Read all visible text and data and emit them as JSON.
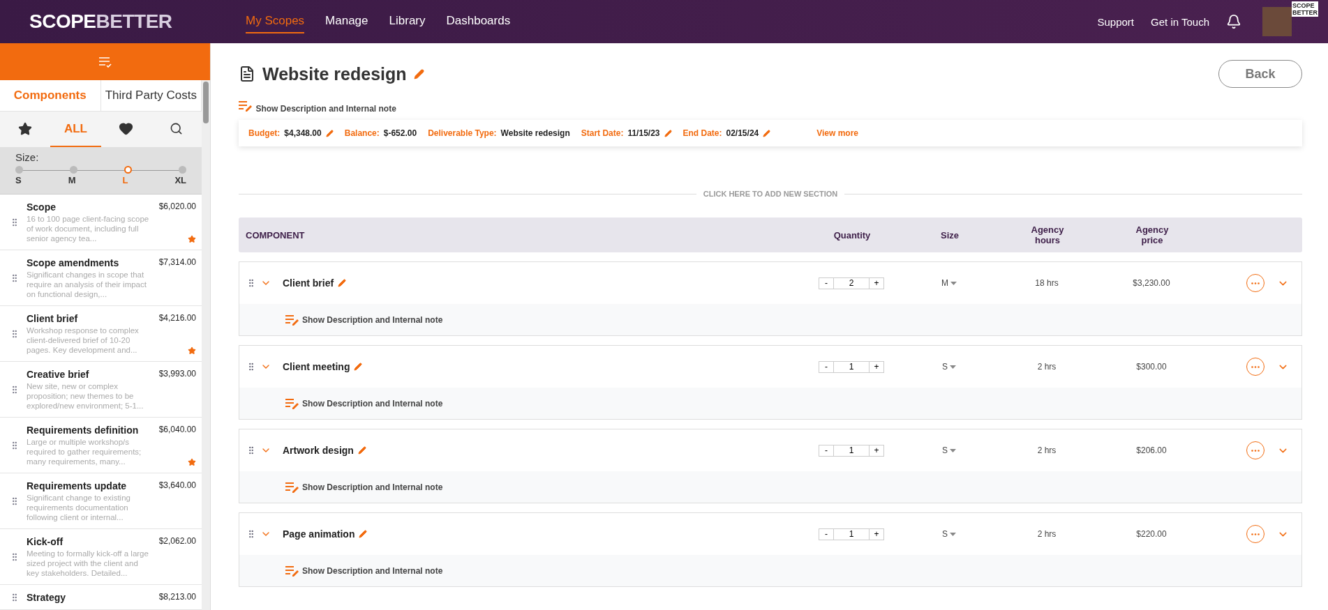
{
  "header": {
    "logo_left": "SCOPE",
    "logo_right": "BETTER",
    "nav": [
      {
        "label": "My Scopes",
        "selected": true
      },
      {
        "label": "Manage",
        "selected": false
      },
      {
        "label": "Library",
        "selected": false
      },
      {
        "label": "Dashboards",
        "selected": false
      }
    ],
    "links": [
      "Support",
      "Get in Touch"
    ],
    "avatar_logo": [
      "SCOPE",
      "BETTER"
    ]
  },
  "sidebar": {
    "tabs": [
      {
        "label": "Components",
        "selected": true
      },
      {
        "label": "Third Party Costs",
        "selected": false
      }
    ],
    "filters": [
      {
        "kind": "star",
        "selected": false
      },
      {
        "kind": "all",
        "label": "ALL",
        "selected": true
      },
      {
        "kind": "heart",
        "selected": false
      },
      {
        "kind": "search",
        "selected": false
      }
    ],
    "size": {
      "label": "Size:",
      "options": [
        {
          "label": "S",
          "selected": false
        },
        {
          "label": "M",
          "selected": false
        },
        {
          "label": "L",
          "selected": true
        },
        {
          "label": "XL",
          "selected": false
        }
      ]
    },
    "components": [
      {
        "name": "Scope",
        "price": "$6,020.00",
        "description": "16 to 100 page client-facing scope of work document, including full senior agency tea...",
        "starred": true
      },
      {
        "name": "Scope amendments",
        "price": "$7,314.00",
        "description": "Significant changes in scope that require an analysis of their impact on functional design,...",
        "starred": false
      },
      {
        "name": "Client brief",
        "price": "$4,216.00",
        "description": "Workshop response to complex client-delivered brief of 10-20 pages. Key development and...",
        "starred": true
      },
      {
        "name": "Creative brief",
        "price": "$3,993.00",
        "description": "New site, new or complex proposition; new themes to be explored/new environment; 5-1...",
        "starred": false
      },
      {
        "name": "Requirements definition",
        "price": "$6,040.00",
        "description": "Large or multiple workshop/s required to gather requirements; many requirements, many...",
        "starred": true
      },
      {
        "name": "Requirements update",
        "price": "$3,640.00",
        "description": "Significant change to existing requirements documentation following client or internal...",
        "starred": false
      },
      {
        "name": "Kick-off",
        "price": "$2,062.00",
        "description": "Meeting to formally kick-off a large sized project with the client and key stakeholders. Detailed...",
        "starred": false
      },
      {
        "name": "Strategy",
        "price": "$8,213.00",
        "starred": false
      }
    ]
  },
  "main": {
    "title": "Website redesign",
    "back": "Back",
    "show_note": "Show Description and Internal note",
    "info": [
      {
        "label": "Budget:",
        "value": "$4,348.00",
        "editable": true
      },
      {
        "label": "Balance:",
        "value": "$-652.00",
        "editable": false
      },
      {
        "label": "Deliverable Type:",
        "value": "Website redesign",
        "editable": false
      },
      {
        "label": "Start Date:",
        "value": "11/15/23",
        "editable": true
      },
      {
        "label": "End Date:",
        "value": "02/15/24",
        "editable": true
      }
    ],
    "view_more": "View more",
    "add_section": "CLICK HERE TO ADD NEW SECTION",
    "columns": [
      "COMPONENT",
      "Quantity",
      "Size",
      "Agency hours",
      "Agency price"
    ],
    "rows": [
      {
        "name": "Client brief",
        "minus": "-",
        "quantity": "2",
        "plus": "+",
        "size": "M",
        "hours": "18 hrs",
        "price": "$3,230.00",
        "note": "Show Description and Internal note"
      },
      {
        "name": "Client meeting",
        "minus": "-",
        "quantity": "1",
        "plus": "+",
        "size": "S",
        "hours": "2 hrs",
        "price": "$300.00",
        "note": "Show Description and Internal note"
      },
      {
        "name": "Artwork design",
        "minus": "-",
        "quantity": "1",
        "plus": "+",
        "size": "S",
        "hours": "2 hrs",
        "price": "$206.00",
        "note": "Show Description and Internal note"
      },
      {
        "name": "Page animation",
        "minus": "-",
        "quantity": "1",
        "plus": "+",
        "size": "S",
        "hours": "2 hrs",
        "price": "$220.00",
        "note": "Show Description and Internal note"
      }
    ]
  }
}
